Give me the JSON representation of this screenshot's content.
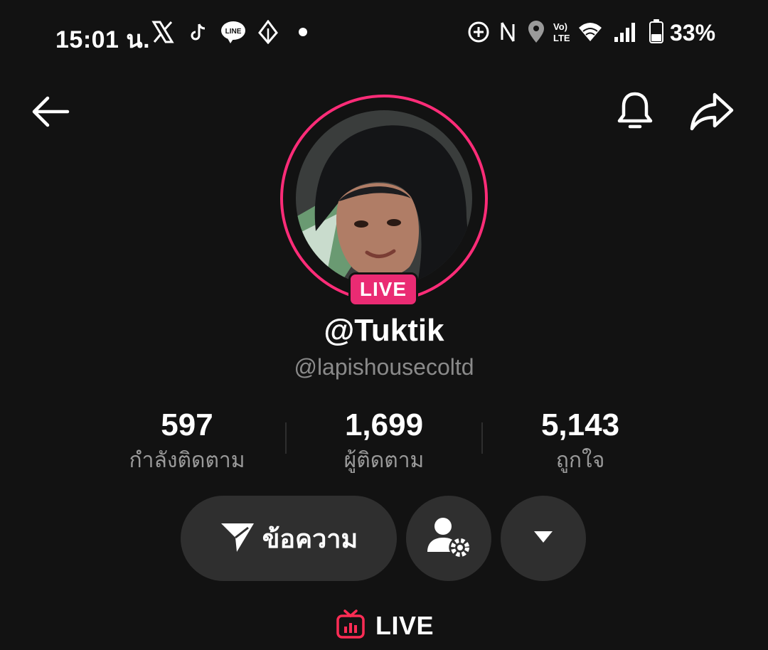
{
  "status_bar": {
    "time": "15:01 น.",
    "battery": "33%",
    "notification_icons": [
      "x-icon",
      "tiktok-icon",
      "line-icon",
      "diamond-icon",
      "dot-icon"
    ],
    "system_icons": [
      "add-circle-icon",
      "nfc-icon",
      "location-icon",
      "volte-icon",
      "wifi-icon",
      "signal-icon",
      "battery-icon"
    ]
  },
  "header": {
    "back_icon": "arrow-left-icon",
    "bell_icon": "bell-icon",
    "share_icon": "share-icon"
  },
  "profile": {
    "live_badge": "LIVE",
    "display_name": "@Tuktik",
    "username": "@lapishousecoltd"
  },
  "stats": [
    {
      "value": "597",
      "label": "กำลังติดตาม"
    },
    {
      "value": "1,699",
      "label": "ผู้ติดตาม"
    },
    {
      "value": "5,143",
      "label": "ถูกใจ"
    }
  ],
  "actions": {
    "message_label": "ข้อความ",
    "message_icon": "send-icon",
    "follow_settings_icon": "user-gear-icon",
    "more_icon": "caret-down-icon"
  },
  "live_tab": {
    "label": "LIVE",
    "icon": "tv-icon"
  },
  "colors": {
    "background": "#121212",
    "accent": "#fe2c78",
    "button_bg": "#2f2f2f",
    "secondary_text": "#8a8a8a"
  }
}
